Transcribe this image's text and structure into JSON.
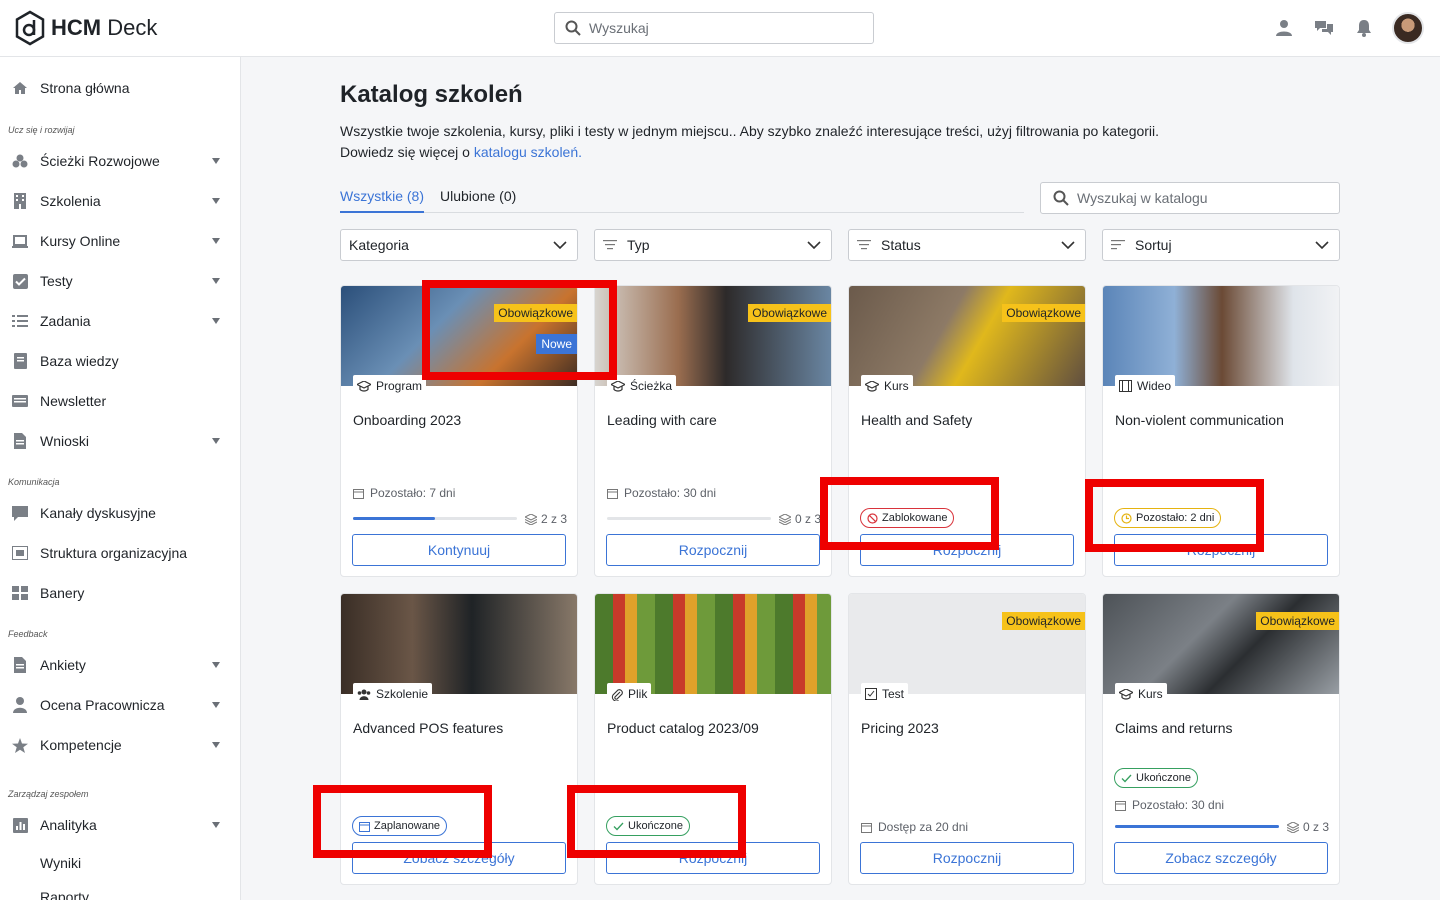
{
  "app": {
    "logo_text_bold": "HCM",
    "logo_text_rest": " Deck",
    "search_placeholder": "Wyszukaj"
  },
  "sidebar": {
    "home": "Strona główna",
    "section_learn": "Ucz się i rozwijaj",
    "paths": "Ścieżki Rozwojowe",
    "trainings": "Szkolenia",
    "online_courses": "Kursy Online",
    "tests": "Testy",
    "tasks": "Zadania",
    "knowledge": "Baza wiedzy",
    "newsletter": "Newsletter",
    "requests": "Wnioski",
    "section_comm": "Komunikacja",
    "channels": "Kanały dyskusyjne",
    "org": "Struktura organizacyjna",
    "banners": "Banery",
    "section_feedback": "Feedback",
    "surveys": "Ankiety",
    "evaluation": "Ocena Pracownicza",
    "competences": "Kompetencje",
    "section_team": "Zarządzaj zespołem",
    "analytics": "Analityka",
    "results": "Wyniki",
    "reports": "Raporty"
  },
  "main": {
    "title": "Katalog szkoleń",
    "desc_line1": "Wszystkie twoje szkolenia, kursy, pliki i testy w jednym miejscu.. Aby szybko znaleźć interesujące treści, użyj filtrowania po kategorii.",
    "desc_line2_prefix": "Dowiedz się więcej o ",
    "desc_link": "katalogu szkoleń.",
    "tab_all": "Wszystkie (8)",
    "tab_fav": "Ulubione (0)",
    "catalog_search_placeholder": "Wyszukaj w katalogu",
    "filters": [
      "Kategoria",
      "Typ",
      "Status",
      "Sortuj"
    ]
  },
  "badges": {
    "mandatory": "Obowiązkowe",
    "new": "Nowe"
  },
  "cards": [
    {
      "type": "Program",
      "title": "Onboarding 2023",
      "meta": "Pozostało: 7 dni",
      "count": "2 z 3",
      "progress": 0.5,
      "button": "Kontynuuj"
    },
    {
      "type": "Ścieżka",
      "title": "Leading with care",
      "meta": "Pozostało: 30 dni",
      "count": "0 z 3",
      "progress": 0,
      "button": "Rozpocznij"
    },
    {
      "type": "Kurs",
      "title": "Health and Safety",
      "status": "Zablokowane",
      "button": "Rozpocznij"
    },
    {
      "type": "Wideo",
      "title": "Non-violent communication",
      "status": "Pozostało: 2 dni",
      "button": "Rozpocznij"
    },
    {
      "type": "Szkolenie",
      "title": "Advanced POS features",
      "status": "Zaplanowane",
      "button": "Zobacz szczegóły"
    },
    {
      "type": "Plik",
      "title": "Product catalog 2023/09",
      "status": "Ukończone",
      "button": "Rozpocznij"
    },
    {
      "type": "Test",
      "title": "Pricing 2023",
      "meta": "Dostęp za 20 dni",
      "button": "Rozpocznij"
    },
    {
      "type": "Kurs",
      "title": "Claims and returns",
      "status": "Ukończone",
      "meta": "Pozostało: 30 dni",
      "count": "0 z 3",
      "progress": 1.0,
      "button": "Zobacz szczegóły"
    }
  ]
}
